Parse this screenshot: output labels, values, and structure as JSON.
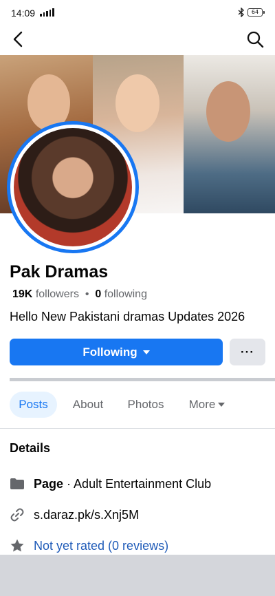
{
  "status": {
    "time": "14:09",
    "battery": "64"
  },
  "profile": {
    "name": "Pak Dramas",
    "followers_count": "19K",
    "followers_label": "followers",
    "separator": "•",
    "following_count": "0",
    "following_label": "following",
    "bio": "Hello New Pakistani dramas Updates 2026"
  },
  "actions": {
    "following_label": "Following",
    "more_label": "···"
  },
  "tabs": [
    {
      "label": "Posts",
      "active": true
    },
    {
      "label": "About"
    },
    {
      "label": "Photos"
    },
    {
      "label": "More"
    }
  ],
  "details": {
    "title": "Details",
    "category_type": "Page",
    "category_sep": " · ",
    "category": "Adult Entertainment Club",
    "link": "s.daraz.pk/s.Xnj5M",
    "rating": "Not yet rated (0 reviews)"
  },
  "icons": {
    "back": "back-arrow-icon",
    "search": "search-icon",
    "page": "folder-icon",
    "link": "link-icon",
    "rating": "star-icon"
  },
  "colors": {
    "accent": "#1877f2",
    "muted": "#65676b",
    "link": "#1f5bb8"
  }
}
